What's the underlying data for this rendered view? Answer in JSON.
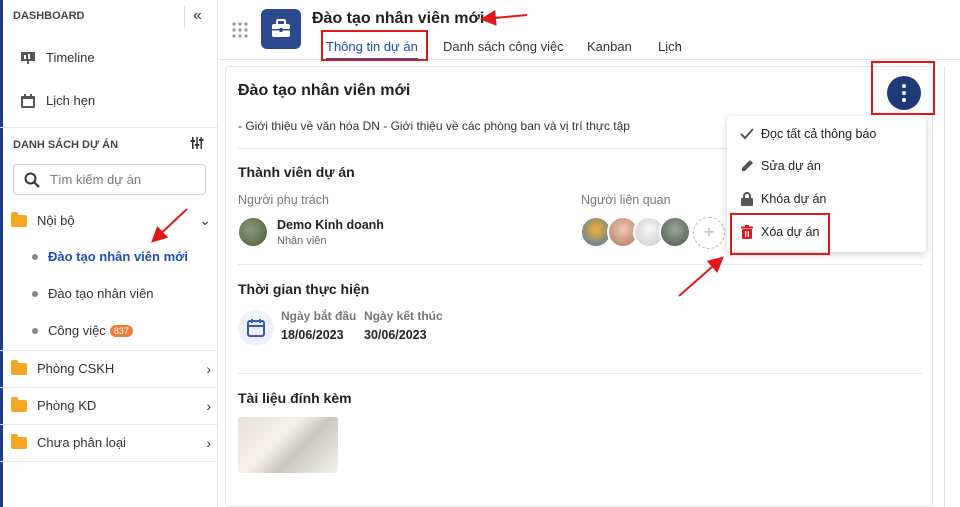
{
  "sidebar": {
    "header": "DASHBOARD",
    "collapse_icon": "double-chevron-left-icon",
    "nav": [
      {
        "label": "Timeline",
        "icon": "presentation-icon"
      },
      {
        "label": "Lịch hẹn",
        "icon": "calendar-icon"
      }
    ],
    "section_title": "DANH SÁCH DỰ ÁN",
    "search_placeholder": "Tìm kiếm dự án",
    "folders": [
      {
        "label": "Nội bộ",
        "expanded": true
      },
      {
        "label": "Phòng CSKH",
        "expanded": false
      },
      {
        "label": "Phòng KD",
        "expanded": false
      },
      {
        "label": "Chưa phân loại",
        "expanded": false
      }
    ],
    "sub_items": [
      {
        "label": "Đào tạo nhân viên mới",
        "active": true
      },
      {
        "label": "Đào tạo nhân viên",
        "active": false
      },
      {
        "label": "Công việc",
        "badge": "837"
      }
    ]
  },
  "header": {
    "title": "Đào tạo nhân viên mới",
    "tabs": [
      "Thông tin dự án",
      "Danh sách công việc",
      "Kanban",
      "Lịch"
    ],
    "active_tab": 0
  },
  "card": {
    "title": "Đào tạo nhân viên mới",
    "description": "- Giới thiệu về văn hóa DN - Giới thiệu về các phòng ban và vị trí thực tập",
    "members_heading": "Thành viên dự án",
    "owner_label": "Người phụ trách",
    "related_label": "Người liên quan",
    "owner_name": "Demo Kinh doanh",
    "owner_role": "Nhân viên",
    "time_heading": "Thời gian thực hiện",
    "start_label": "Ngày bắt đầu",
    "start_value": "18/06/2023",
    "end_label": "Ngày kết thúc",
    "end_value": "30/06/2023",
    "attach_heading": "Tài liệu đính kèm"
  },
  "menu": {
    "items": [
      {
        "label": "Đọc tất cả thông báo",
        "icon": "check-icon"
      },
      {
        "label": "Sửa dự án",
        "icon": "pencil-icon"
      },
      {
        "label": "Khóa dự án",
        "icon": "lock-icon"
      },
      {
        "label": "Xóa dự án",
        "icon": "trash-icon"
      }
    ]
  },
  "colors": {
    "accent": "#1e3a78",
    "brand": "#2b4a8f",
    "danger": "#e01818",
    "folder": "#f5a623",
    "badge": "#f07c3a"
  }
}
